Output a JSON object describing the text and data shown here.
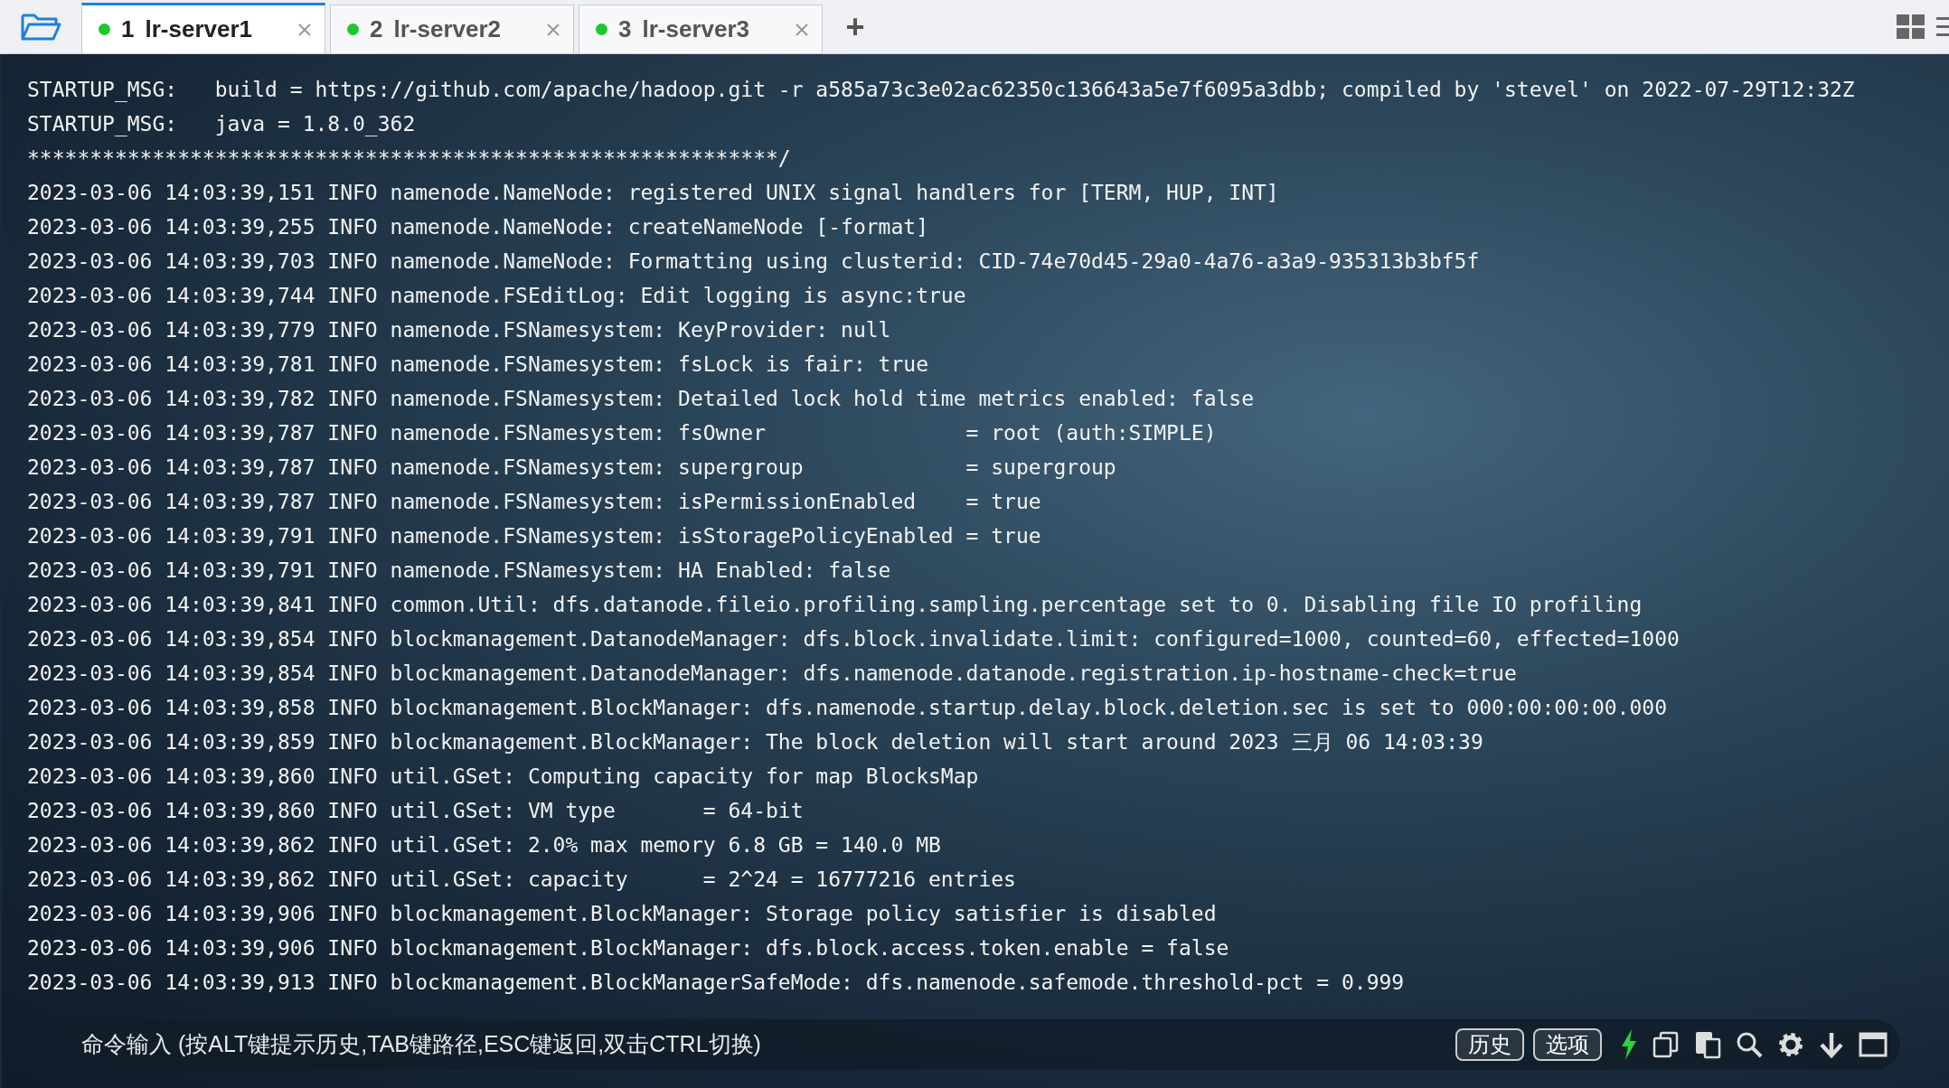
{
  "tabs": [
    {
      "number": "1",
      "label": "lr-server1",
      "selected": true,
      "connected": true
    },
    {
      "number": "2",
      "label": "lr-server2",
      "selected": false,
      "connected": true
    },
    {
      "number": "3",
      "label": "lr-server3",
      "selected": false,
      "connected": true
    }
  ],
  "new_tab": "+",
  "terminal": {
    "lines": [
      "STARTUP_MSG:   build = https://github.com/apache/hadoop.git -r a585a73c3e02ac62350c136643a5e7f6095a3dbb; compiled by 'stevel' on 2022-07-29T12:32Z",
      "STARTUP_MSG:   java = 1.8.0_362",
      "************************************************************/",
      "2023-03-06 14:03:39,151 INFO namenode.NameNode: registered UNIX signal handlers for [TERM, HUP, INT]",
      "2023-03-06 14:03:39,255 INFO namenode.NameNode: createNameNode [-format]",
      "2023-03-06 14:03:39,703 INFO namenode.NameNode: Formatting using clusterid: CID-74e70d45-29a0-4a76-a3a9-935313b3bf5f",
      "2023-03-06 14:03:39,744 INFO namenode.FSEditLog: Edit logging is async:true",
      "2023-03-06 14:03:39,779 INFO namenode.FSNamesystem: KeyProvider: null",
      "2023-03-06 14:03:39,781 INFO namenode.FSNamesystem: fsLock is fair: true",
      "2023-03-06 14:03:39,782 INFO namenode.FSNamesystem: Detailed lock hold time metrics enabled: false",
      "2023-03-06 14:03:39,787 INFO namenode.FSNamesystem: fsOwner                = root (auth:SIMPLE)",
      "2023-03-06 14:03:39,787 INFO namenode.FSNamesystem: supergroup             = supergroup",
      "2023-03-06 14:03:39,787 INFO namenode.FSNamesystem: isPermissionEnabled    = true",
      "2023-03-06 14:03:39,791 INFO namenode.FSNamesystem: isStoragePolicyEnabled = true",
      "2023-03-06 14:03:39,791 INFO namenode.FSNamesystem: HA Enabled: false",
      "2023-03-06 14:03:39,841 INFO common.Util: dfs.datanode.fileio.profiling.sampling.percentage set to 0. Disabling file IO profiling",
      "2023-03-06 14:03:39,854 INFO blockmanagement.DatanodeManager: dfs.block.invalidate.limit: configured=1000, counted=60, effected=1000",
      "2023-03-06 14:03:39,854 INFO blockmanagement.DatanodeManager: dfs.namenode.datanode.registration.ip-hostname-check=true",
      "2023-03-06 14:03:39,858 INFO blockmanagement.BlockManager: dfs.namenode.startup.delay.block.deletion.sec is set to 000:00:00:00.000",
      "2023-03-06 14:03:39,859 INFO blockmanagement.BlockManager: The block deletion will start around 2023 三月 06 14:03:39",
      "2023-03-06 14:03:39,860 INFO util.GSet: Computing capacity for map BlocksMap",
      "2023-03-06 14:03:39,860 INFO util.GSet: VM type       = 64-bit",
      "2023-03-06 14:03:39,862 INFO util.GSet: 2.0% max memory 6.8 GB = 140.0 MB",
      "2023-03-06 14:03:39,862 INFO util.GSet: capacity      = 2^24 = 16777216 entries",
      "2023-03-06 14:03:39,906 INFO blockmanagement.BlockManager: Storage policy satisfier is disabled",
      "2023-03-06 14:03:39,906 INFO blockmanagement.BlockManager: dfs.block.access.token.enable = false",
      "2023-03-06 14:03:39,913 INFO blockmanagement.BlockManagerSafeMode: dfs.namenode.safemode.threshold-pct = 0.999"
    ]
  },
  "command_bar": {
    "placeholder": "命令输入 (按ALT键提示历史,TAB键路径,ESC键返回,双击CTRL切换)",
    "buttons": [
      "历史",
      "选项"
    ]
  }
}
